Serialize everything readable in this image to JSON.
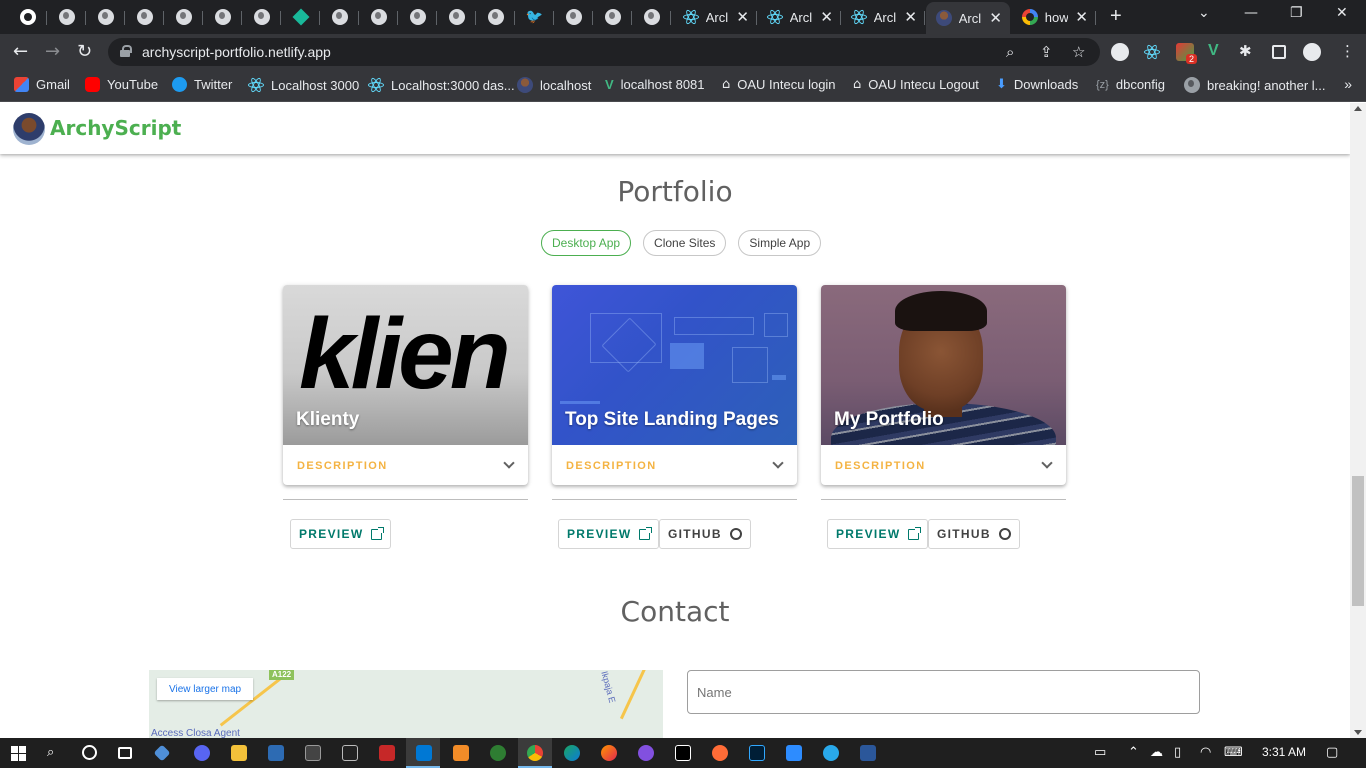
{
  "browser": {
    "tabs": [
      {
        "title": "Arcl",
        "icon": "react-icon"
      },
      {
        "title": "Arcl",
        "icon": "react-icon"
      },
      {
        "title": "Arcl",
        "icon": "react-icon"
      },
      {
        "title": "Arcl",
        "icon": "avatar-icon",
        "active": true
      },
      {
        "title": "how",
        "icon": "google-icon"
      }
    ],
    "url": "archyscript-portfolio.netlify.app",
    "extension_badge": "2",
    "bookmarks": [
      {
        "label": "Gmail",
        "icon": "gmail-icon"
      },
      {
        "label": "YouTube",
        "icon": "youtube-icon"
      },
      {
        "label": "Twitter",
        "icon": "twitter-icon"
      },
      {
        "label": "Localhost 3000",
        "icon": "react-icon"
      },
      {
        "label": "Localhost:3000 das...",
        "icon": "react-icon"
      },
      {
        "label": "localhost",
        "icon": "avatar-icon"
      },
      {
        "label": "localhost 8081",
        "icon": "vue-icon"
      },
      {
        "label": "OAU Intecu login",
        "icon": "house-icon"
      },
      {
        "label": "OAU Intecu Logout",
        "icon": "house-icon"
      },
      {
        "label": "Downloads",
        "icon": "download-icon"
      },
      {
        "label": "dbconfig",
        "icon": "json-icon"
      },
      {
        "label": "breaking! another l...",
        "icon": "globe-icon"
      }
    ]
  },
  "site": {
    "brand": "ArchyScript",
    "brand_color": "#4caf50",
    "portfolio": {
      "title": "Portfolio",
      "filters": [
        "Desktop App",
        "Clone Sites",
        "Simple App"
      ],
      "active_filter": "Desktop App",
      "cards": [
        {
          "title": "Klienty",
          "image_text": "klien",
          "description_label": "DESCRIPTION",
          "preview_label": "PREVIEW"
        },
        {
          "title": "Top Site Landing Pages",
          "description_label": "DESCRIPTION",
          "preview_label": "PREVIEW",
          "github_label": "GITHUB"
        },
        {
          "title": "My Portfolio",
          "description_label": "DESCRIPTION",
          "preview_label": "PREVIEW",
          "github_label": "GITHUB"
        }
      ]
    },
    "contact": {
      "title": "Contact",
      "map_button": "View larger map",
      "map_road_label": "A122",
      "map_place_label": "Access Closa Agent",
      "map_street_label": "Ikpaja E",
      "name_placeholder": "Name"
    }
  },
  "taskbar": {
    "time": "3:31 AM"
  }
}
